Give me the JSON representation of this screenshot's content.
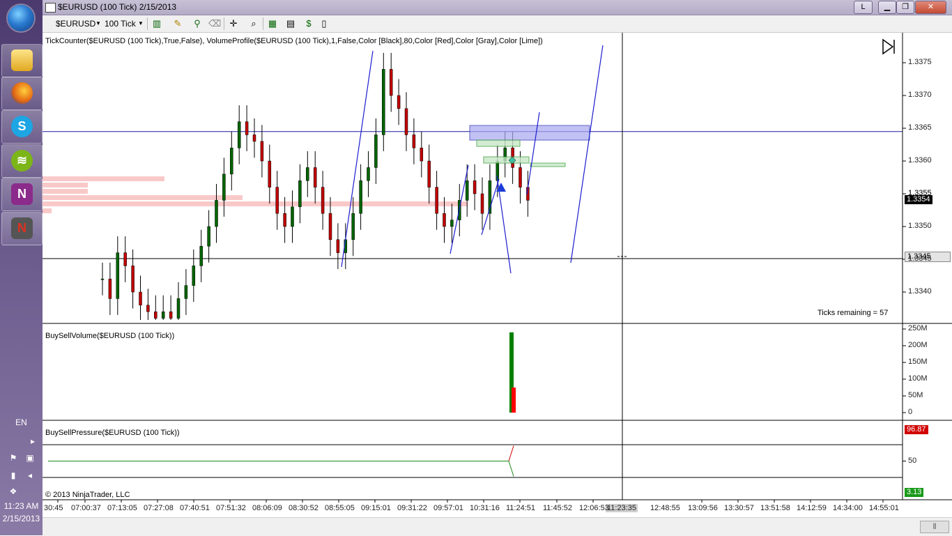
{
  "window": {
    "title": "$EURUSD (100 Tick)  2/15/2013",
    "buttons": {
      "link": "L",
      "minimize": "",
      "restore": "",
      "close": ""
    }
  },
  "toolbar": {
    "instrument": "$EURUSD",
    "interval": "100 Tick"
  },
  "taskbar": {
    "language": "EN",
    "time": "11:23 AM",
    "date": "2/15/2013",
    "apps": [
      "explorer-icon",
      "firefox-icon",
      "skype-icon",
      "spotify-icon",
      "onenote-icon",
      "ninjatrader-icon"
    ]
  },
  "panels": {
    "price": {
      "indicator_label": "TickCounter($EURUSD (100 Tick),True,False), VolumeProfile($EURUSD (100 Tick),1,False,Color [Black],80,Color [Red],Color [Gray],Color [Lime])",
      "ticks_remaining": "Ticks remaining = 57",
      "current_price": "1.3354",
      "crosshair_price": "1.3345",
      "partial_label": "1.3355"
    },
    "volume": {
      "indicator_label": "BuySellVolume($EURUSD (100 Tick))"
    },
    "pressure": {
      "indicator_label": "BuySellPressure($EURUSD (100 Tick))",
      "buy_value": "96.87",
      "sell_value": "3.13",
      "copyright": "© 2013 NinjaTrader, LLC"
    }
  },
  "time_axis": {
    "labels": [
      "30:45",
      "07:00:37",
      "07:13:05",
      "07:27:08",
      "07:40:51",
      "07:51:32",
      "08:06:09",
      "08:30:52",
      "08:55:05",
      "09:15:01",
      "09:31:22",
      "09:57:01",
      "10:31:16",
      "11:24:51",
      "11:45:52",
      "12:06:53",
      "13:09:56",
      "13:30:57",
      "13:51:58",
      "14:12:59",
      "14:34:00",
      "14:55:01"
    ],
    "partial_left": "12:48:55",
    "cursor_time": "11:23:35"
  },
  "colors": {
    "up": "#006400",
    "down": "#c00000",
    "trendline": "#1c1cd0",
    "profile": "#f8c0c0",
    "buy_volume": "#008000",
    "sell_volume": "#ff0000"
  },
  "chart_data": [
    {
      "type": "candlestick",
      "title": "",
      "y_axis_ticks": [
        "1.3375",
        "1.3370",
        "1.3365",
        "1.3360",
        "1.3355",
        "1.3350",
        "1.3345",
        "1.3340"
      ],
      "ylim": [
        1.3336,
        1.3378
      ],
      "horizontal_lines": [
        1.33645,
        1.33451
      ],
      "series": [
        {
          "name": "",
          "close_values": [
            1.3342,
            1.3339,
            1.3346,
            1.3344,
            1.334,
            1.3338,
            1.3337,
            1.3336,
            1.3337,
            1.3336,
            1.3339,
            1.3341,
            1.3344,
            1.3347,
            1.335,
            1.3354,
            1.3358,
            1.3362,
            1.3366,
            1.3364,
            1.3363,
            1.336,
            1.3356,
            1.3352,
            1.335,
            1.3353,
            1.3357,
            1.3359,
            1.3356,
            1.3352,
            1.3348,
            1.3346,
            1.3348,
            1.3352,
            1.3357,
            1.3359,
            1.3364,
            1.3374,
            1.337,
            1.3368,
            1.3364,
            1.3362,
            1.336,
            1.3356,
            1.3352,
            1.335,
            1.3351,
            1.3354,
            1.3357,
            1.3355,
            1.3352,
            1.3357,
            1.336,
            1.3362,
            1.3359,
            1.3356,
            1.3354
          ]
        }
      ]
    },
    {
      "type": "bar",
      "title": "",
      "y_axis_ticks": [
        "250M",
        "200M",
        "150M",
        "100M",
        "50M",
        "0"
      ],
      "ylim": [
        0,
        260
      ],
      "series": [
        {
          "name": "",
          "values": [
            240
          ]
        },
        {
          "name": "",
          "values": [
            75
          ]
        }
      ]
    },
    {
      "type": "line",
      "title": "",
      "y_axis_ticks": [
        "50"
      ],
      "ylim": [
        0,
        100
      ],
      "series": [
        {
          "name": "",
          "values": [
            50,
            50,
            50,
            96.87
          ]
        },
        {
          "name": "",
          "values": [
            50,
            50,
            50,
            3.13
          ]
        }
      ]
    }
  ]
}
